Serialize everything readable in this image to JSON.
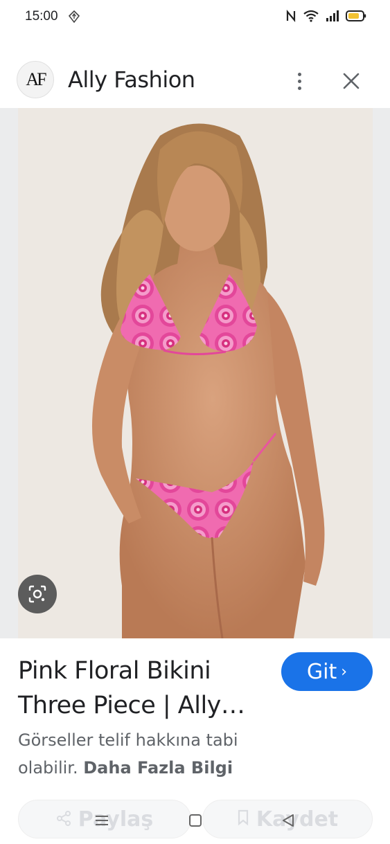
{
  "status_bar": {
    "time": "15:00",
    "icons": [
      "navigation-icon",
      "nfc-icon",
      "wifi-icon",
      "signal-icon",
      "battery-icon"
    ]
  },
  "header": {
    "logo_text": "AF",
    "title": "Ally Fashion",
    "icons": [
      "more-vert-icon",
      "close-icon"
    ]
  },
  "image": {
    "lens_icon": "lens-icon"
  },
  "result": {
    "title": "Pink Floral Bikini Three Piece | Ally…",
    "go_label": "Git",
    "go_chevron": "›",
    "notice_text": "Görseller telif hakkına tabi olabilir.",
    "more_info": "Daha Fazla Bilgi"
  },
  "actions": {
    "share_label": "Paylaş",
    "save_label": "Kaydet"
  },
  "nav": {
    "icons": [
      "menu-icon",
      "home-square-icon",
      "back-triangle-icon"
    ]
  },
  "colors": {
    "accent": "#1a73e8",
    "background": "#ffffff",
    "image_frame": "#ebeced"
  }
}
